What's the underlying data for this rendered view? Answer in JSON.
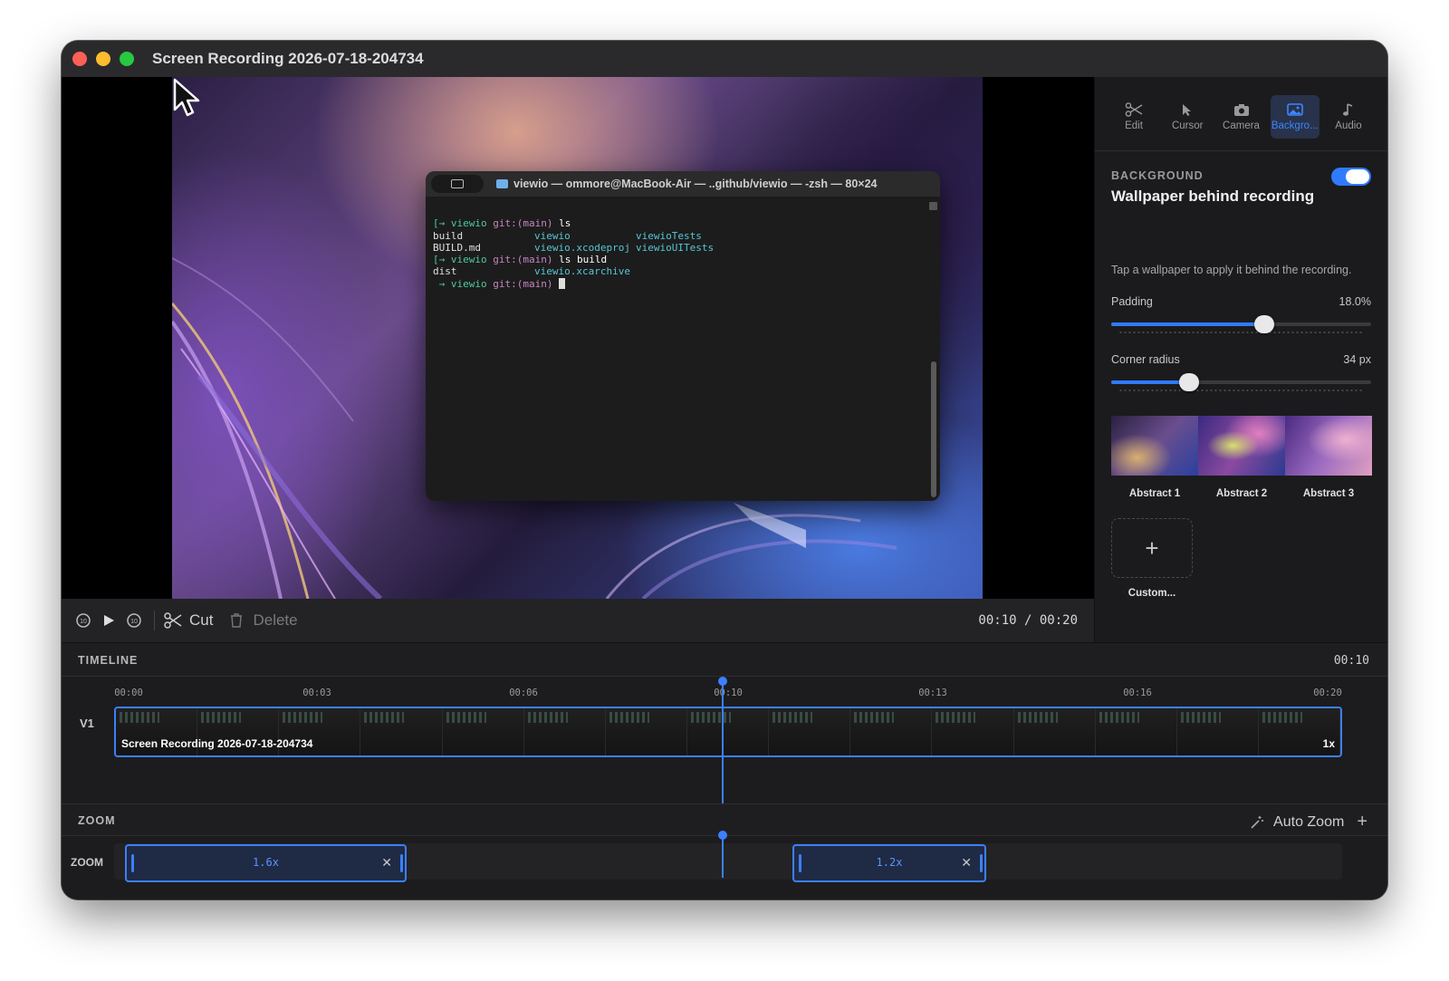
{
  "window": {
    "title": "Screen Recording 2026-07-18-204734"
  },
  "terminal": {
    "title": "viewio — ommore@MacBook-Air — ..github/viewio — -zsh — 80×24",
    "lines": [
      {
        "prompt": "[→ viewio ",
        "branch": "git:(main) ",
        "cmd": "ls"
      },
      {
        "cols": [
          "build",
          "viewio",
          "viewioTests"
        ]
      },
      {
        "cols": [
          "BUILD.md",
          "viewio.xcodeproj",
          "viewioUITests"
        ]
      },
      {
        "prompt": "[→ viewio ",
        "branch": "git:(main) ",
        "cmd": "ls build"
      },
      {
        "cols": [
          "dist",
          "viewio.xcarchive",
          ""
        ]
      },
      {
        "prompt": " → viewio ",
        "branch": "git:(main) ",
        "cmd": ""
      }
    ]
  },
  "controls": {
    "cut_label": "Cut",
    "delete_label": "Delete",
    "timecode": "00:10 / 00:20"
  },
  "sidebar": {
    "tabs": [
      {
        "label": "Edit",
        "icon": "scissors-icon"
      },
      {
        "label": "Cursor",
        "icon": "cursor-icon"
      },
      {
        "label": "Camera",
        "icon": "camera-icon"
      },
      {
        "label": "Backgro...",
        "icon": "image-icon",
        "active": true
      },
      {
        "label": "Audio",
        "icon": "music-note-icon"
      }
    ],
    "section_kicker": "BACKGROUND",
    "section_title": "Wallpaper behind recording",
    "toggle_on": true,
    "description": "Tap a wallpaper to apply it behind the recording.",
    "padding": {
      "label": "Padding",
      "value": "18.0%",
      "fraction": 0.59
    },
    "corner_radius": {
      "label": "Corner radius",
      "value": "34 px",
      "fraction": 0.3
    },
    "wallpapers": [
      "Abstract 1",
      "Abstract 2",
      "Abstract 3"
    ],
    "custom_label": "Custom..."
  },
  "timeline": {
    "label": "TIMELINE",
    "current_time": "00:10",
    "ruler": [
      "00:00",
      "00:03",
      "00:06",
      "00:10",
      "00:13",
      "00:16",
      "00:20"
    ],
    "track_label": "V1",
    "clip_name": "Screen Recording 2026-07-18-204734",
    "clip_speed": "1x",
    "playhead_fraction": 0.5
  },
  "zoom": {
    "label": "ZOOM",
    "track_label": "ZOOM",
    "auto_zoom_label": "Auto Zoom",
    "segments": [
      {
        "label": "1.6x",
        "start": 0.0,
        "end": 0.21
      },
      {
        "label": "1.2x",
        "start": 0.55,
        "end": 0.71
      }
    ]
  },
  "colors": {
    "accent": "#3d7fff",
    "window_bg": "#1e1e20"
  }
}
